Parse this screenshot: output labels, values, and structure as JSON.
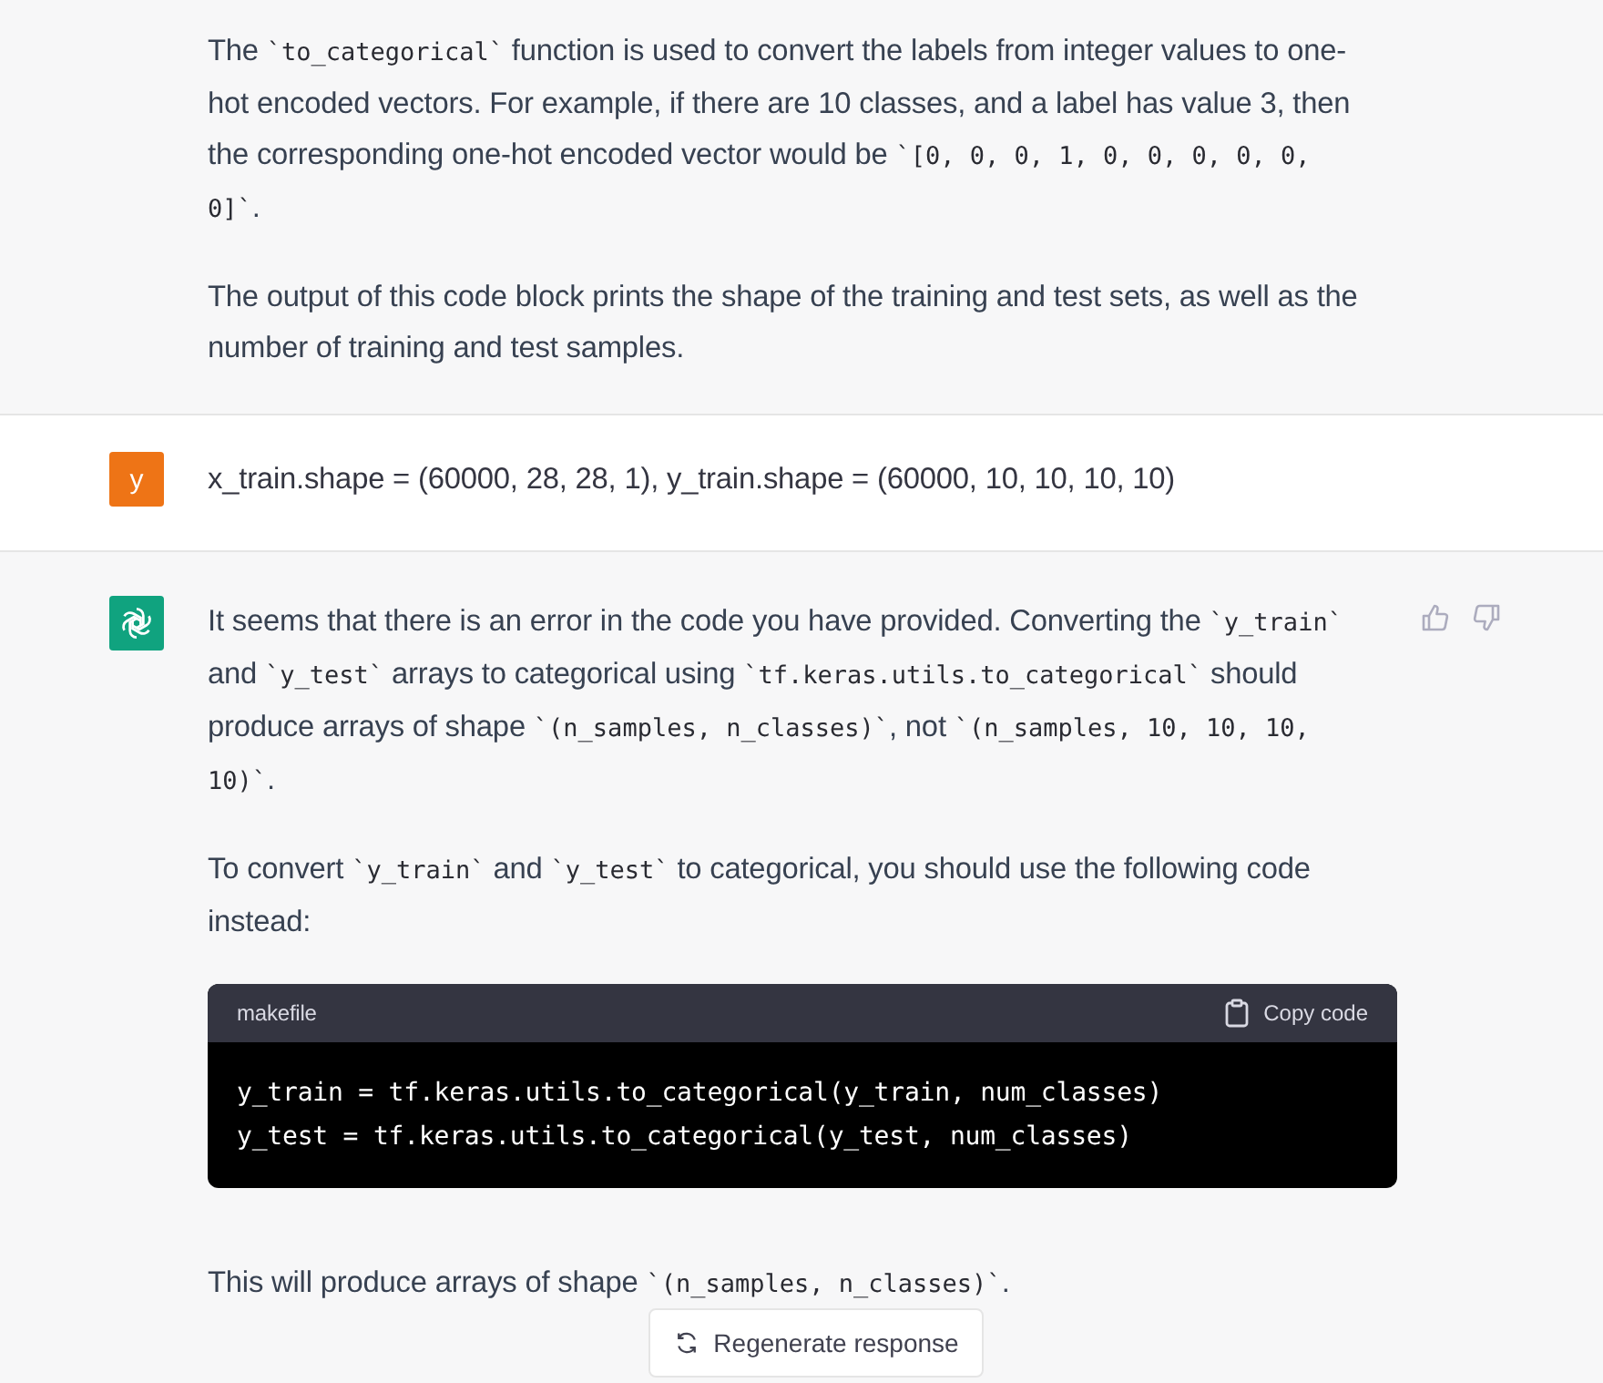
{
  "messages": [
    {
      "kind": "continuation",
      "paragraphs": [
        [
          {
            "kind": "text",
            "text": "The "
          },
          {
            "kind": "code",
            "text": "`to_categorical`"
          },
          {
            "kind": "text",
            "text": " function is used to convert the labels from integer values to one-hot encoded vectors. For example, if there are 10 classes, and a label has value 3, then the corresponding one-hot encoded vector would be "
          },
          {
            "kind": "code",
            "text": "`[0, 0, 0, 1, 0, 0, 0, 0, 0, 0]`"
          },
          {
            "kind": "text",
            "text": "."
          }
        ],
        [
          {
            "kind": "text",
            "text": "The output of this code block prints the shape of the training and test sets, as well as the number of training and test samples."
          }
        ]
      ]
    },
    {
      "kind": "user",
      "avatar": "y",
      "paragraphs": [
        [
          {
            "kind": "text",
            "text": "x_train.shape = (60000, 28, 28, 1), y_train.shape = (60000, 10, 10, 10, 10)"
          }
        ]
      ]
    },
    {
      "kind": "assistant",
      "feedback": true,
      "paragraphs": [
        [
          {
            "kind": "text",
            "text": "It seems that there is an error in the code you have provided. Converting the "
          },
          {
            "kind": "code",
            "text": "`y_train`"
          },
          {
            "kind": "text",
            "text": " and "
          },
          {
            "kind": "code",
            "text": "`y_test`"
          },
          {
            "kind": "text",
            "text": " arrays to categorical using "
          },
          {
            "kind": "code",
            "text": "`tf.keras.utils.to_categorical`"
          },
          {
            "kind": "text",
            "text": " should produce arrays of shape "
          },
          {
            "kind": "code",
            "text": "`(n_samples, n_classes)`"
          },
          {
            "kind": "text",
            "text": ", not "
          },
          {
            "kind": "code",
            "text": "`(n_samples, 10, 10, 10, 10)`"
          },
          {
            "kind": "text",
            "text": "."
          }
        ],
        [
          {
            "kind": "text",
            "text": "To convert "
          },
          {
            "kind": "code",
            "text": "`y_train`"
          },
          {
            "kind": "text",
            "text": " and "
          },
          {
            "kind": "code",
            "text": "`y_test`"
          },
          {
            "kind": "text",
            "text": " to categorical, you should use the following code instead:"
          }
        ],
        {
          "code_block": {
            "language": "makefile",
            "copy_label": "Copy code",
            "lines": [
              "y_train = tf.keras.utils.to_categorical(y_train, num_classes)",
              "y_test = tf.keras.utils.to_categorical(y_test, num_classes)"
            ]
          }
        },
        [
          {
            "kind": "text",
            "text": "This will produce arrays of shape "
          },
          {
            "kind": "code",
            "text": "`(n_samples, n_classes)`"
          },
          {
            "kind": "text",
            "text": "."
          }
        ]
      ]
    }
  ],
  "regenerate_button": {
    "label": "Regenerate response"
  }
}
